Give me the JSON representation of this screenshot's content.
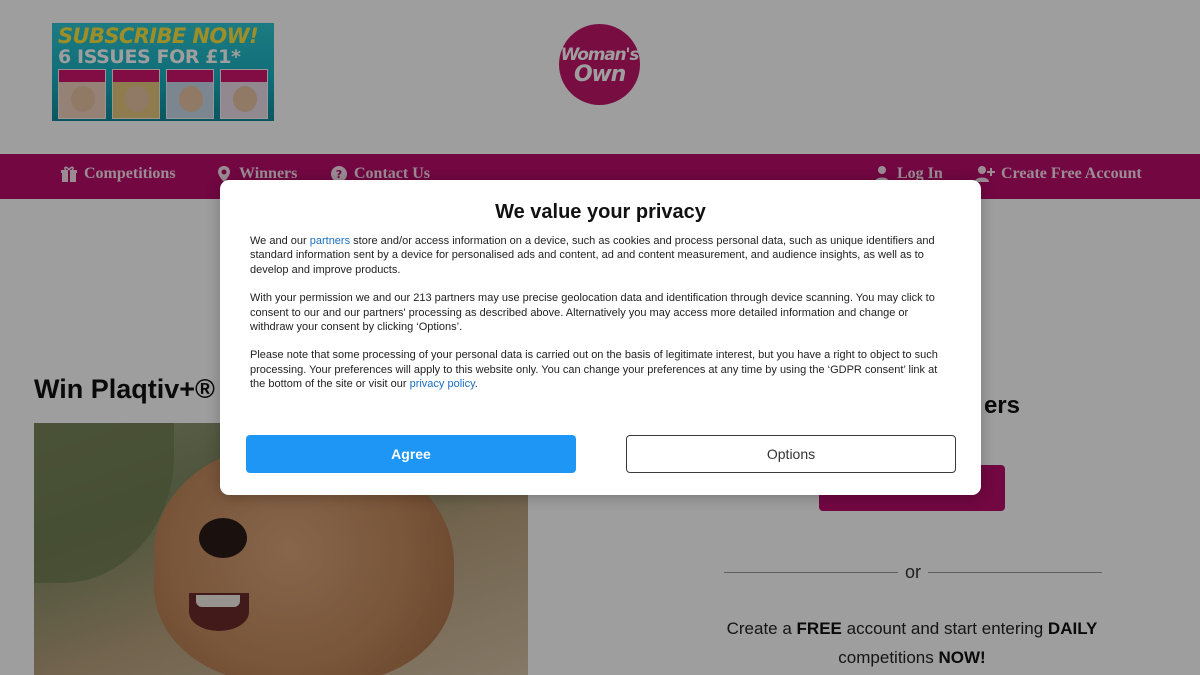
{
  "header": {
    "promo": {
      "line1": "SUBSCRIBE NOW!",
      "line2": "6 ISSUES FOR £1*"
    },
    "logo": {
      "line1": "Woman's",
      "line2": "Own"
    }
  },
  "nav": {
    "left": [
      {
        "label": "Competitions",
        "icon": "gift-icon"
      },
      {
        "label": "Winners",
        "icon": "map-pin-icon"
      },
      {
        "label": "Contact Us",
        "icon": "question-circle-icon"
      }
    ],
    "right": [
      {
        "label": "Log In",
        "icon": "user-icon"
      },
      {
        "label": "Create Free Account",
        "icon": "user-plus-icon"
      }
    ]
  },
  "article": {
    "title": "Win Plaqtiv+®"
  },
  "sidebar": {
    "title_visible": "ers",
    "or_text": "or",
    "signup": {
      "part1": "Create a ",
      "free": "FREE",
      "part2": " account and start entering ",
      "daily": "DAILY",
      "part3": " competitions ",
      "now": "NOW!"
    }
  },
  "consent": {
    "title": "We value your privacy",
    "p1_before_link": "We and our ",
    "p1_link": "partners",
    "p1_after_link": " store and/or access information on a device, such as cookies and process personal data, such as unique identifiers and standard information sent by a device for personalised ads and content, ad and content measurement, and audience insights, as well as to develop and improve products.",
    "p2": "With your permission we and our 213 partners may use precise geolocation data and identification through device scanning. You may click to consent to our and our partners' processing as described above. Alternatively you may access more detailed information and change or withdraw your consent by clicking ‘Options’.",
    "p3_before_link": "Please note that some processing of your personal data is carried out on the basis of legitimate interest, but you have a right to object to such processing. Your preferences will apply to this website only. You can change your preferences at any time by using the ‘GDPR consent’ link at the bottom of the site or visit our ",
    "p3_link": "privacy policy",
    "p3_after_link": ".",
    "agree_label": "Agree",
    "options_label": "Options"
  },
  "colors": {
    "brand": "#b80c6b",
    "agree": "#1e96f5",
    "link": "#1a6fc4"
  }
}
